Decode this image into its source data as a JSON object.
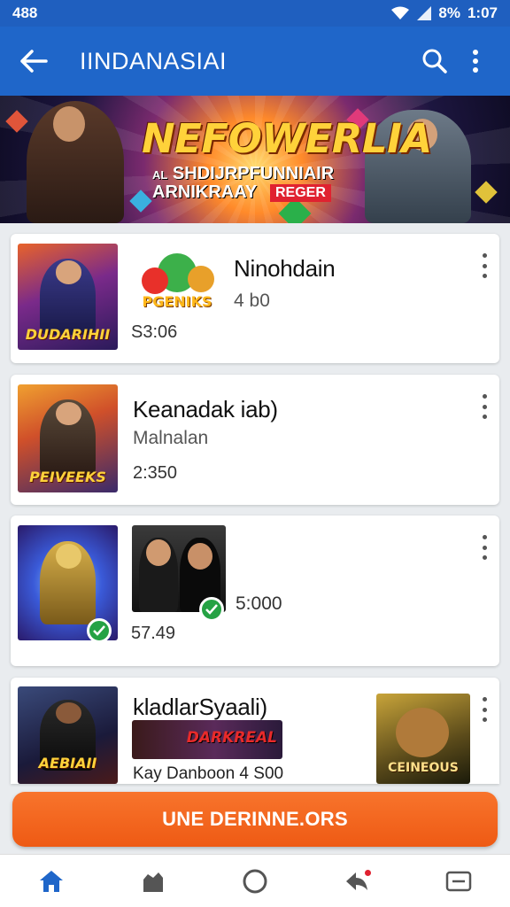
{
  "status_bar": {
    "time_left": "488",
    "battery": "8%",
    "clock": "1:07"
  },
  "app_bar": {
    "title": "IINDANASIAI"
  },
  "banner": {
    "title": "NEFOWERLIA",
    "line1": "SHDIJRPFUNNIAIR",
    "line1_prefix": "AL",
    "line2": "ARNIKRAAY",
    "tag": "REGER"
  },
  "cards": [
    {
      "title": "Ninohdain",
      "subtitle": "4 b0",
      "meta": "S3:06",
      "thumb_caption": "DUDARIHII",
      "art_caption": "PGENIKS"
    },
    {
      "title": "Keanadak iab)",
      "subtitle": "Malnalan",
      "meta": "2:350",
      "thumb_caption": "PEIVEEKS"
    },
    {
      "title": "",
      "subtitle": "5:000",
      "meta": "57.49"
    },
    {
      "title": "kladlarSyaali)",
      "subtitle": "Kay Danboon 4 S00",
      "art_caption": "DARKREAL",
      "thumb_caption": "AEBIAII",
      "art2_caption": "CEINEOUS"
    }
  ],
  "cta": {
    "label": "UNE DERINNE.ORS"
  },
  "bottom_nav": [
    "home-icon",
    "castle-icon",
    "circle-icon",
    "share-icon",
    "menu-icon"
  ],
  "colors": {
    "primary": "#1f66c9",
    "accent": "#ee5a14",
    "success": "#25a244"
  }
}
